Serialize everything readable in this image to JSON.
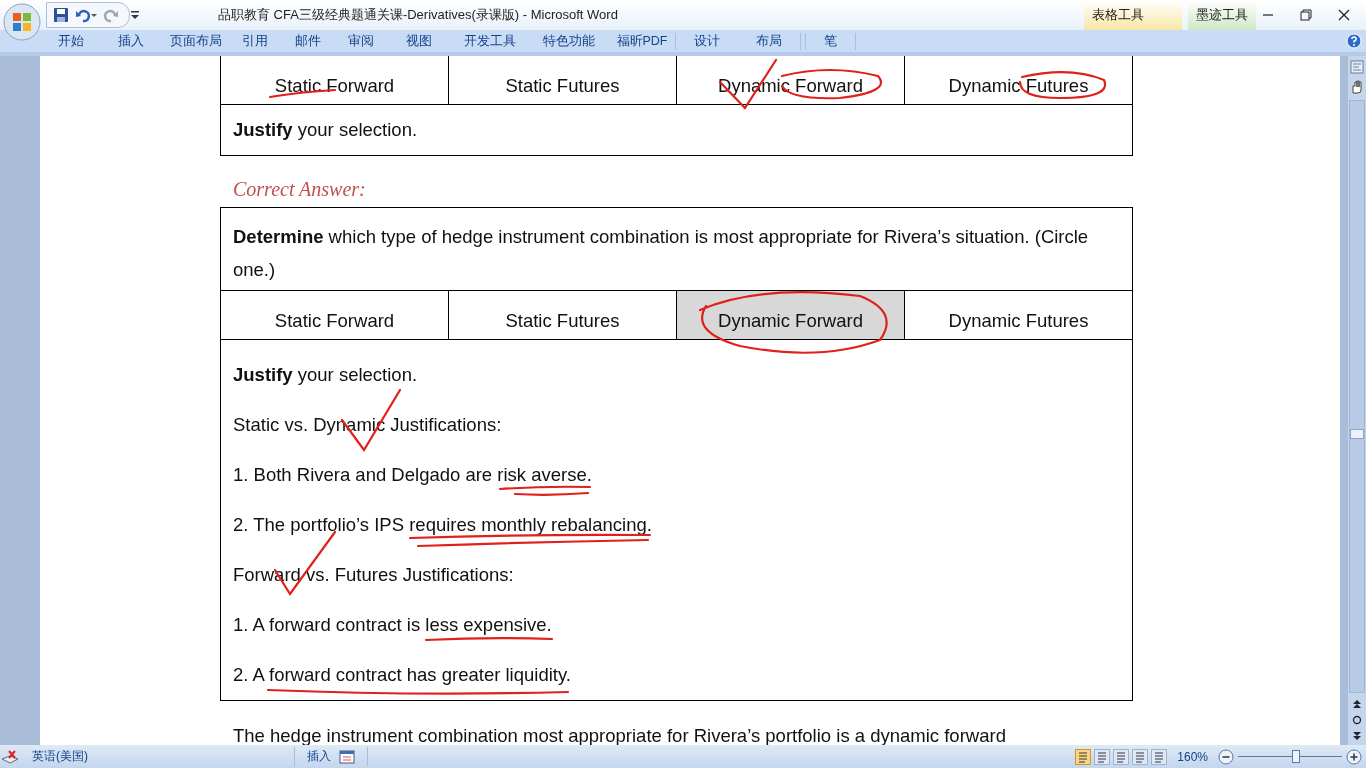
{
  "window": {
    "title": "品职教育 CFA三级经典题通关课-Derivatives(录课版)  -  Microsoft Word"
  },
  "ribbon": {
    "tabs": [
      "开始",
      "插入",
      "页面布局",
      "引用",
      "邮件",
      "审阅",
      "视图",
      "开发工具",
      "特色功能",
      "福昕PDF"
    ],
    "contextual_groups": [
      {
        "label": "表格工具",
        "color": "#f7e7a6",
        "tabs": [
          "设计",
          "布局"
        ]
      },
      {
        "label": "墨迹工具",
        "color": "#cfe8c4",
        "tabs": [
          "笔"
        ]
      }
    ]
  },
  "document": {
    "question_table": {
      "choices": [
        {
          "label": "Static Forward",
          "selected": false
        },
        {
          "label": "Static Futures",
          "selected": false
        },
        {
          "label": "Dynamic Forward",
          "selected": false
        },
        {
          "label": "Dynamic Futures",
          "selected": false
        }
      ],
      "justify_prompt": "**Justify** your selection."
    },
    "answer_heading": "Correct Answer:",
    "answer_table": {
      "prompt": "**Determine** which type of hedge instrument combination is most appropriate for Rivera’s situation. (Circle one.)",
      "choices": [
        {
          "label": "Static Forward",
          "selected": false
        },
        {
          "label": "Static Futures",
          "selected": false
        },
        {
          "label": "Dynamic Forward",
          "selected": true
        },
        {
          "label": "Dynamic Futures",
          "selected": false
        }
      ],
      "justify_prompt": "**Justify** your selection.",
      "justification_lines": [
        "Static vs. Dynamic Justifications:",
        "1. Both Rivera and Delgado are risk averse.",
        "2. The portfolio’s IPS requires monthly rebalancing.",
        "Forward vs. Futures Justifications:",
        "1. A forward contract is less expensive.",
        "2. A forward contract has greater liquidity."
      ]
    },
    "closing_paragraph": "The hedge instrument combination most appropriate for Rivera’s portfolio is a dynamic forward"
  },
  "status_bar": {
    "language": "英语(美国)",
    "mode": "插入",
    "zoom": "160%",
    "zoom_slider": {
      "level": 0.56
    }
  }
}
